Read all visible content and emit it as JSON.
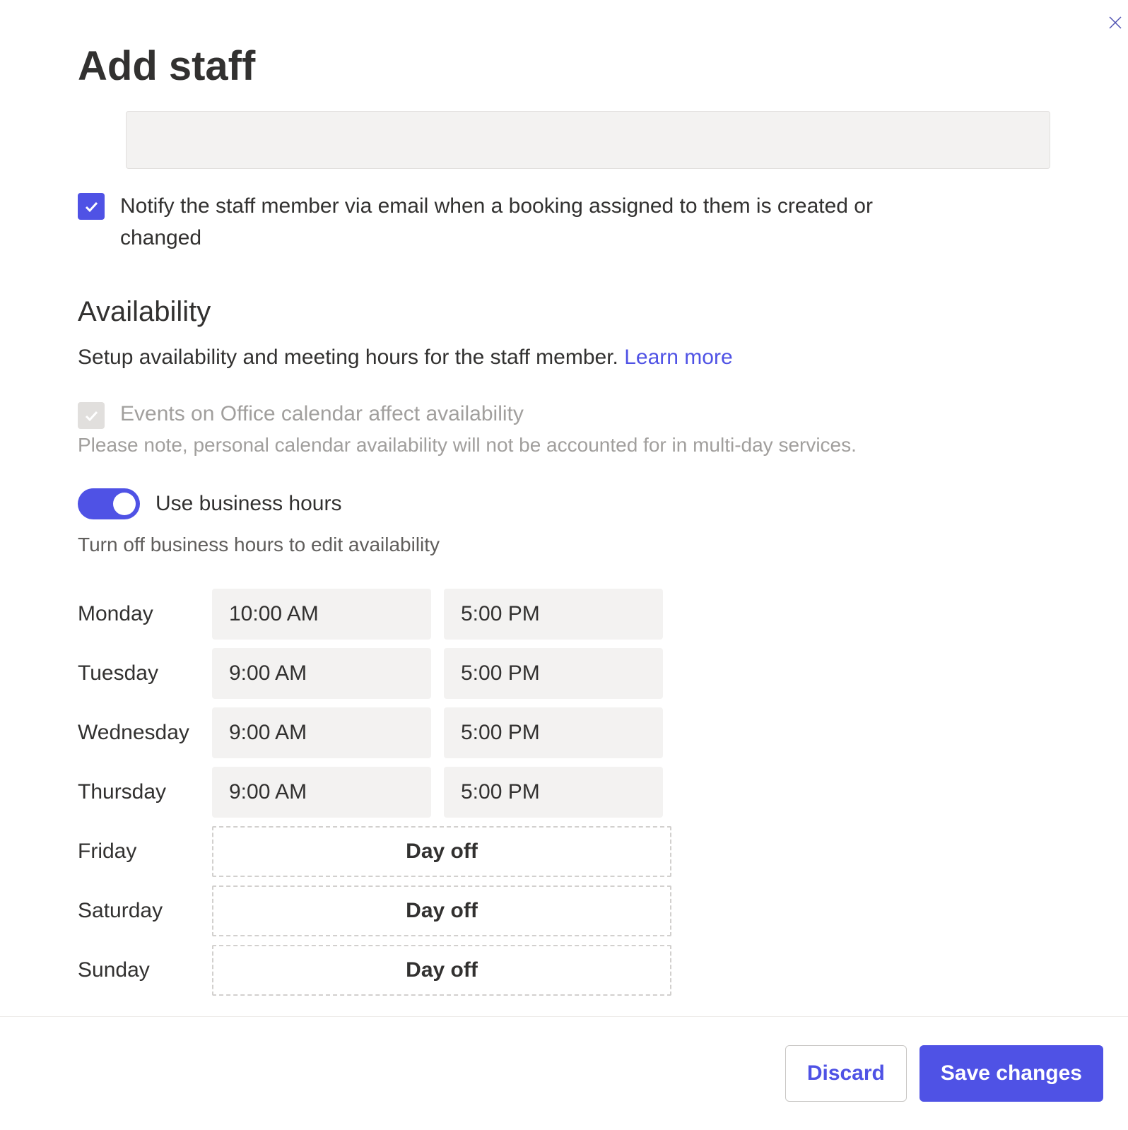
{
  "header": {
    "title": "Add staff"
  },
  "notify": {
    "label": "Notify the staff member via email when a booking assigned to them is created or changed"
  },
  "availability": {
    "title": "Availability",
    "description": "Setup availability and meeting hours for the staff member.",
    "learn_more": "Learn more",
    "calendar_affect_label": "Events on Office calendar affect availability",
    "calendar_note": "Please note, personal calendar availability will not be accounted for in multi-day services.",
    "use_business_hours_label": "Use business hours",
    "business_hours_hint": "Turn off business hours to edit availability"
  },
  "schedule": [
    {
      "day": "Monday",
      "start": "10:00 AM",
      "end": "5:00 PM",
      "off": false
    },
    {
      "day": "Tuesday",
      "start": "9:00 AM",
      "end": "5:00 PM",
      "off": false
    },
    {
      "day": "Wednesday",
      "start": "9:00 AM",
      "end": "5:00 PM",
      "off": false
    },
    {
      "day": "Thursday",
      "start": "9:00 AM",
      "end": "5:00 PM",
      "off": false
    },
    {
      "day": "Friday",
      "off": true
    },
    {
      "day": "Saturday",
      "off": true
    },
    {
      "day": "Sunday",
      "off": true
    }
  ],
  "day_off_label": "Day off",
  "footer": {
    "discard": "Discard",
    "save": "Save changes"
  }
}
